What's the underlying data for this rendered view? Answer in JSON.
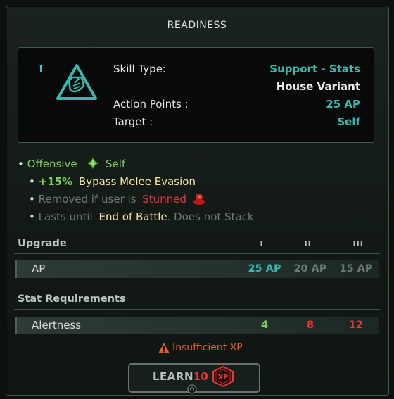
{
  "title": "READINESS",
  "skill": {
    "rank": "I",
    "icon": "readiness-skill-icon",
    "skill_type_label": "Skill Type:",
    "skill_type_value": "Support - Stats",
    "variant": "House Variant",
    "action_points_label": "Action Points :",
    "action_points_value": "25 AP",
    "target_label": "Target :",
    "target_value": "Self"
  },
  "effects": {
    "category": "Offensive",
    "category_icon": "green-diamond-icon",
    "target": "Self",
    "line1_value": "+15%",
    "line1_text": "Bypass Melee Evasion",
    "line2_text": "Removed if user is",
    "line2_status": "Stunned",
    "line2_icon": "stunned-icon",
    "line3_text": "Lasts until",
    "line3_highlight": "End of Battle",
    "line3_suffix": ". Does not Stack"
  },
  "upgrade": {
    "heading": "Upgrade",
    "tiers": [
      "I",
      "II",
      "III"
    ],
    "ap_label": "AP",
    "ap_values": [
      "25 AP",
      "20 AP",
      "15 AP"
    ]
  },
  "requirements": {
    "heading": "Stat Requirements",
    "stat_label": "Alertness",
    "stat_values": [
      "4",
      "8",
      "12"
    ]
  },
  "warning": "Insufficient XP",
  "learn": {
    "label": "LEARN",
    "cost": "10",
    "currency": "XP"
  },
  "colors": {
    "teal": "#3bb6ac",
    "green": "#7fcf58",
    "red": "#e8343b",
    "yellow": "#f4e6a0",
    "warning": "#e95a2a"
  }
}
